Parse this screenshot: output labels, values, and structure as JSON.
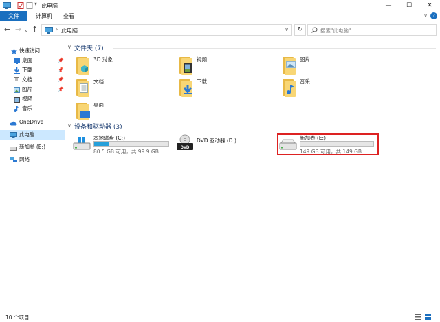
{
  "window": {
    "title": "此电脑",
    "controls": [
      "minimize",
      "maximize",
      "close"
    ]
  },
  "ribbon": {
    "tabs": [
      {
        "label": "文件",
        "active": true
      },
      {
        "label": "计算机",
        "active": false
      },
      {
        "label": "查看",
        "active": false
      }
    ]
  },
  "nav": {
    "breadcrumb": "此电脑",
    "search_placeholder": "搜索\"此电脑\""
  },
  "sidebar": {
    "items": [
      {
        "label": "快速访问",
        "icon": "star-icon",
        "pinned": false
      },
      {
        "label": "桌面",
        "icon": "desktop-icon",
        "pinned": true
      },
      {
        "label": "下载",
        "icon": "download-icon",
        "pinned": true
      },
      {
        "label": "文档",
        "icon": "document-icon",
        "pinned": true
      },
      {
        "label": "图片",
        "icon": "picture-icon",
        "pinned": true
      },
      {
        "label": "视频",
        "icon": "video-icon",
        "pinned": false
      },
      {
        "label": "音乐",
        "icon": "music-icon",
        "pinned": false
      },
      {
        "label": "OneDrive",
        "icon": "cloud-icon",
        "pinned": false
      },
      {
        "label": "此电脑",
        "icon": "computer-icon",
        "pinned": false,
        "selected": true
      },
      {
        "label": "新加卷 (E:)",
        "icon": "drive-icon",
        "pinned": false
      },
      {
        "label": "网络",
        "icon": "network-icon",
        "pinned": false
      }
    ]
  },
  "folders_group": {
    "title": "文件夹 (7)",
    "items": [
      {
        "label": "3D 对象",
        "icon": "3d-objects-icon"
      },
      {
        "label": "视频",
        "icon": "video-folder-icon"
      },
      {
        "label": "图片",
        "icon": "pictures-folder-icon"
      },
      {
        "label": "文档",
        "icon": "documents-folder-icon"
      },
      {
        "label": "下载",
        "icon": "downloads-folder-icon"
      },
      {
        "label": "音乐",
        "icon": "music-folder-icon"
      },
      {
        "label": "桌面",
        "icon": "desktop-folder-icon"
      }
    ]
  },
  "drives_group": {
    "title": "设备和驱动器 (3)",
    "items": [
      {
        "label": "本地磁盘 (C:)",
        "size_text": "80.5 GB 可用，共 99.9 GB",
        "used_fraction": 0.19,
        "icon": "windows-drive-icon"
      },
      {
        "label": "DVD 驱动器 (D:)",
        "size_text": "",
        "icon": "dvd-drive-icon"
      },
      {
        "label": "新加卷 (E:)",
        "size_text": "149 GB 可用，共 149 GB",
        "used_fraction": 0.0,
        "icon": "drive-icon",
        "highlighted": true
      }
    ]
  },
  "status": {
    "count": "10 个项目"
  },
  "colors": {
    "accent": "#1a6fbf",
    "group_header": "#1e3f73",
    "progress": "#26a0da",
    "highlight_border": "#dd2222",
    "selected_bg": "#cce8ff"
  }
}
